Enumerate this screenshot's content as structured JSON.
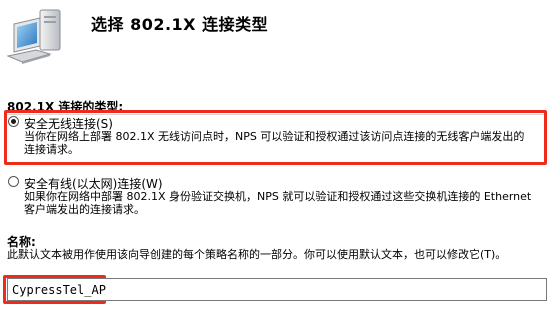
{
  "header": {
    "title": "选择 802.1X 连接类型",
    "icon": "server-computer-icon"
  },
  "connection_type": {
    "group_label": "802.1X 连接的类型:",
    "options": [
      {
        "label": "安全无线连接(S)",
        "description": "当你在网络上部署 802.1X 无线访问点时，NPS 可以验证和授权通过该访问点连接的无线客户端发出的连接请求。",
        "selected": true
      },
      {
        "label": "安全有线(以太网)连接(W)",
        "description": "如果你在网络中部署 802.1X 身份验证交换机，NPS 就可以验证和授权通过这些交换机连接的 Ethernet 客户端发出的连接请求。",
        "selected": false
      }
    ]
  },
  "name": {
    "label": "名称:",
    "description": "此默认文本被用作使用该向导创建的每个策略名称的一部分。你可以使用默认文本，也可以修改它(T)。",
    "value": "CypressTel_AP"
  },
  "colors": {
    "highlight": "#ef2c1c"
  }
}
